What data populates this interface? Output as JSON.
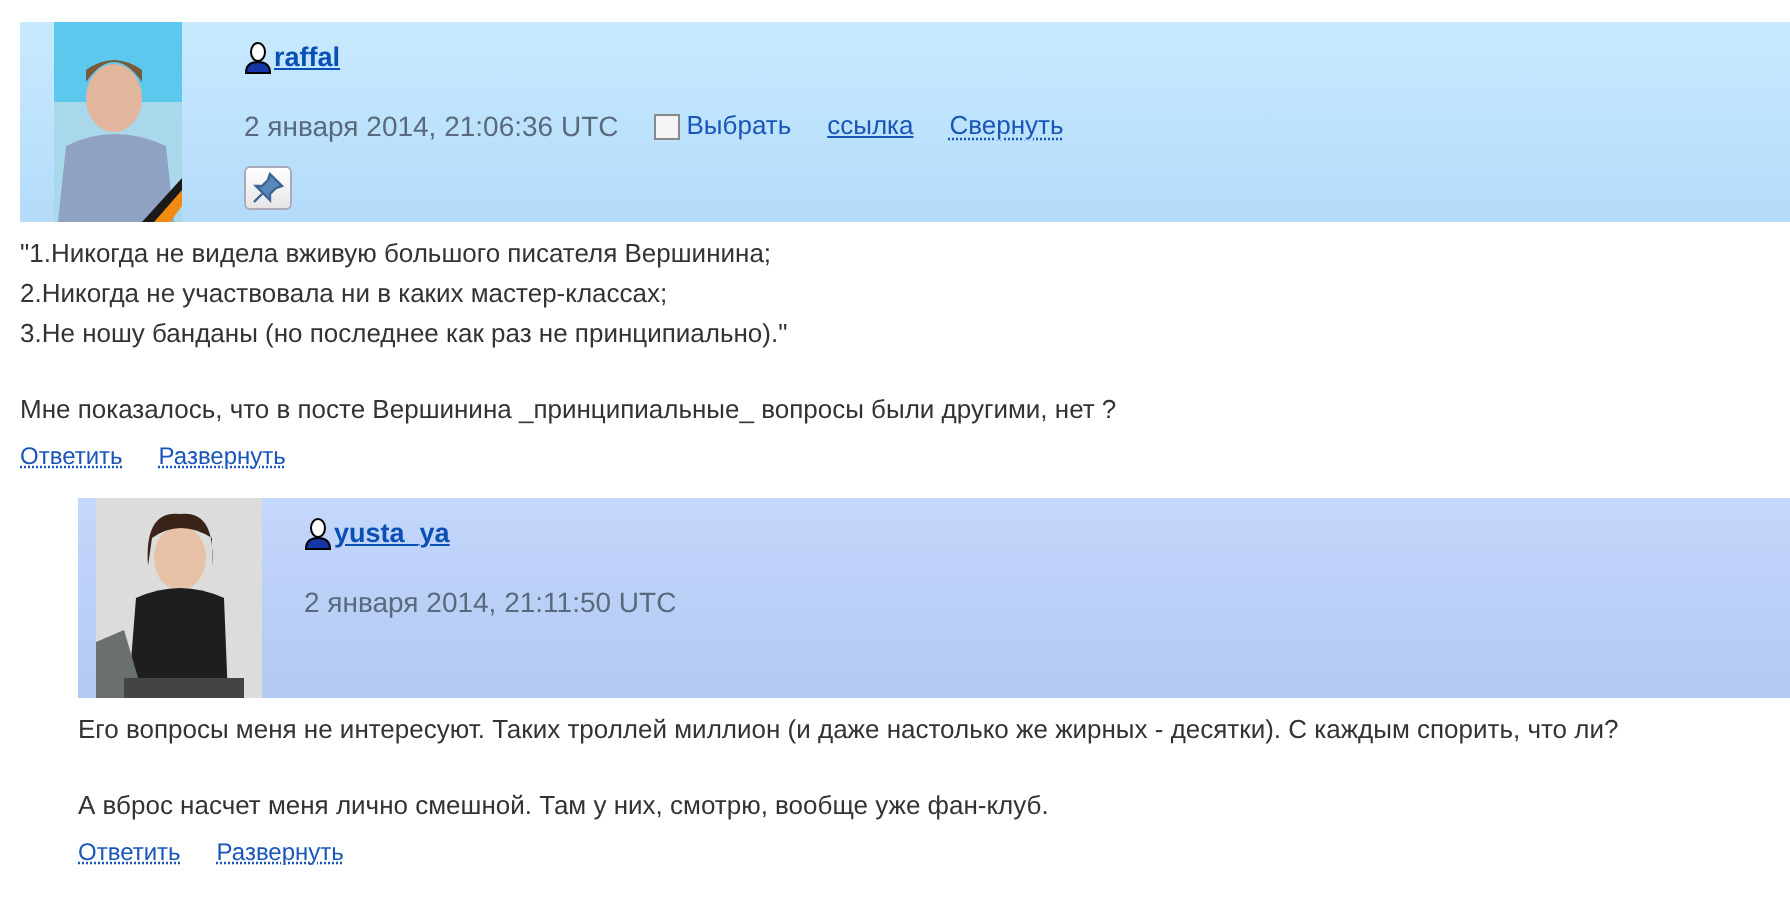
{
  "comments": [
    {
      "username": "raffal",
      "date": "2 января 2014, 21:06:36 UTC",
      "select": {
        "label": "Выбрать",
        "checked": false
      },
      "links": [
        "ссылка",
        "Свернуть"
      ],
      "pin_button": true,
      "paragraphs": [
        [
          "\"1.Никогда не видела вживую большого писателя Вершинина;",
          "2.Никогда не участвовала ни в каких мастер-классах;",
          "3.Не ношу банданы (но последнее как раз не принципиально).\""
        ],
        [
          "Мне показалось, что в посте Вершинина _принципиальные_ вопросы были другими, нет ?"
        ]
      ],
      "actions": [
        "Ответить",
        "Развернуть"
      ],
      "children": [
        {
          "username": "yusta_ya",
          "date": "2 января 2014, 21:11:50 UTC",
          "paragraphs": [
            [
              "Его вопросы меня не интересуют. Таких троллей миллион (и даже настолько же жирных - десятки). С каждым спорить, что ли?"
            ],
            [
              "А вброс насчет меня лично смешной. Там у них, смотрю, вообще уже фан-клуб."
            ]
          ],
          "actions": [
            "Ответить",
            "Развернуть"
          ]
        }
      ]
    }
  ]
}
